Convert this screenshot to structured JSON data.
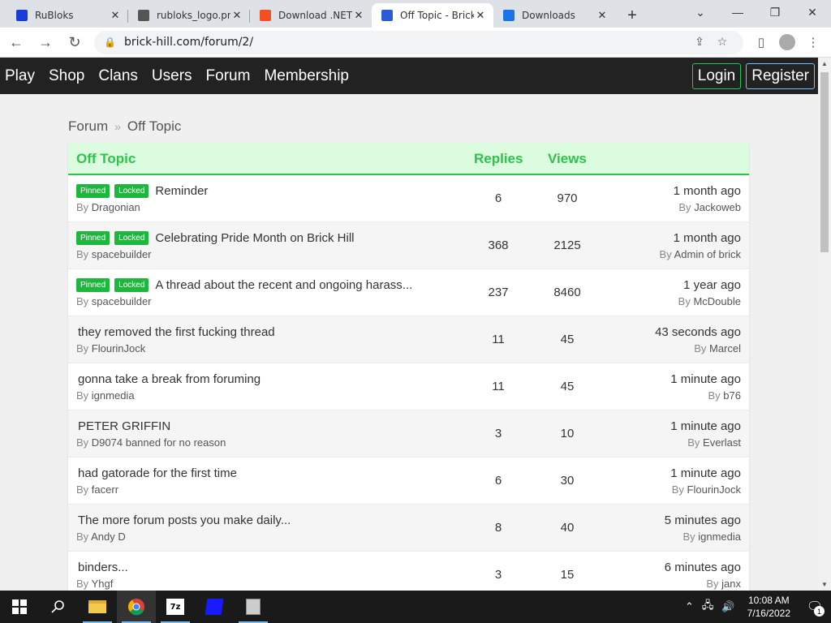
{
  "browser": {
    "tabs": [
      {
        "title": "RuBloks",
        "icon": "rubloks-favicon",
        "color": "#1a3cd6",
        "active": false
      },
      {
        "title": "rubloks_logo.png",
        "icon": "globe-icon",
        "color": "#555555",
        "active": false
      },
      {
        "title": "Download .NET",
        "icon": "microsoft-icon",
        "color": "#f25022",
        "active": false
      },
      {
        "title": "Off Topic - Brick Hill",
        "icon": "brickhill-icon",
        "color": "#2b5bd6",
        "active": true
      },
      {
        "title": "Downloads",
        "icon": "download-icon",
        "color": "#1a73e8",
        "active": false
      }
    ],
    "url": "brick-hill.com/forum/2/"
  },
  "site": {
    "nav": [
      "Play",
      "Shop",
      "Clans",
      "Users",
      "Forum",
      "Membership"
    ],
    "login_label": "Login",
    "register_label": "Register"
  },
  "breadcrumb": {
    "root": "Forum",
    "current": "Off Topic"
  },
  "forum": {
    "header": {
      "title": "Off Topic",
      "replies": "Replies",
      "views": "Views"
    },
    "threads": [
      {
        "pinned": "Pinned",
        "locked": "Locked",
        "title": "Reminder",
        "by_prefix": "By",
        "author": "Dragonian",
        "replies": "6",
        "views": "970",
        "last_time": "1 month ago",
        "last_by": "Jackoweb"
      },
      {
        "pinned": "Pinned",
        "locked": "Locked",
        "title": "Celebrating Pride Month on Brick Hill",
        "by_prefix": "By",
        "author": "spacebuilder",
        "replies": "368",
        "views": "2125",
        "last_time": "1 month ago",
        "last_by": "Admin of brick"
      },
      {
        "pinned": "Pinned",
        "locked": "Locked",
        "title": "A thread about the recent and ongoing harass...",
        "by_prefix": "By",
        "author": "spacebuilder",
        "replies": "237",
        "views": "8460",
        "last_time": "1 year ago",
        "last_by": "McDouble"
      },
      {
        "title": "they removed the first fucking thread",
        "by_prefix": "By",
        "author": "FlourinJock",
        "replies": "11",
        "views": "45",
        "last_time": "43 seconds ago",
        "last_by": "Marcel"
      },
      {
        "title": "gonna take a break from foruming",
        "by_prefix": "By",
        "author": "ignmedia",
        "replies": "11",
        "views": "45",
        "last_time": "1 minute ago",
        "last_by": "b76"
      },
      {
        "title": "PETER GRIFFIN",
        "by_prefix": "By",
        "author": "D9074 banned for no reason",
        "replies": "3",
        "views": "10",
        "last_time": "1 minute ago",
        "last_by": "Everlast"
      },
      {
        "title": "had gatorade for the first time",
        "by_prefix": "By",
        "author": "facerr",
        "replies": "6",
        "views": "30",
        "last_time": "1 minute ago",
        "last_by": "FlourinJock"
      },
      {
        "title": "The more forum posts you make daily...",
        "by_prefix": "By",
        "author": "Andy D",
        "replies": "8",
        "views": "40",
        "last_time": "5 minutes ago",
        "last_by": "ignmedia"
      },
      {
        "title": "binders...",
        "by_prefix": "By",
        "author": "Yhgf",
        "replies": "3",
        "views": "15",
        "last_time": "6 minutes ago",
        "last_by": "janx"
      }
    ]
  },
  "taskbar": {
    "time": "10:08 AM",
    "date": "7/16/2022",
    "notification_count": "1"
  },
  "colors": {
    "accent_green": "#2ec34a",
    "header_bg": "#dcfce0",
    "nav_bg": "#222222"
  }
}
